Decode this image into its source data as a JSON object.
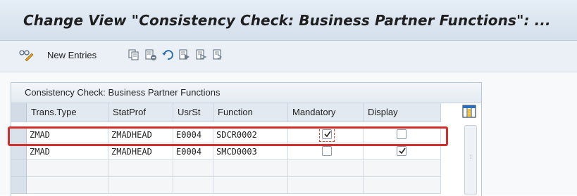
{
  "window": {
    "title": "Change View \"Consistency Check: Business Partner Functions\": ..."
  },
  "toolbar": {
    "new_entries_label": "New Entries",
    "icons": [
      "display-change-icon",
      "new-entries",
      "copy-icon",
      "delete-icon",
      "undo-icon",
      "select-all-icon",
      "select-block-icon",
      "deselect-all-icon"
    ]
  },
  "panel": {
    "title": "Consistency Check: Business Partner Functions"
  },
  "table": {
    "columns": [
      "Trans.Type",
      "StatProf",
      "UsrSt",
      "Function",
      "Mandatory",
      "Display"
    ],
    "rows": [
      {
        "trans_type": "ZMAD",
        "stat_prof": "ZMADHEAD",
        "usr_st": "E0004",
        "function": "SDCR0002",
        "mandatory": true,
        "display": false,
        "highlighted": true
      },
      {
        "trans_type": "ZMAD",
        "stat_prof": "ZMADHEAD",
        "usr_st": "E0004",
        "function": "SMCD0003",
        "mandatory": false,
        "display": true,
        "highlighted": false
      }
    ]
  },
  "colors": {
    "highlight_border": "#d32f2f",
    "header_bg": "#e3e9f0",
    "title_bg": "#dbe5ef"
  }
}
